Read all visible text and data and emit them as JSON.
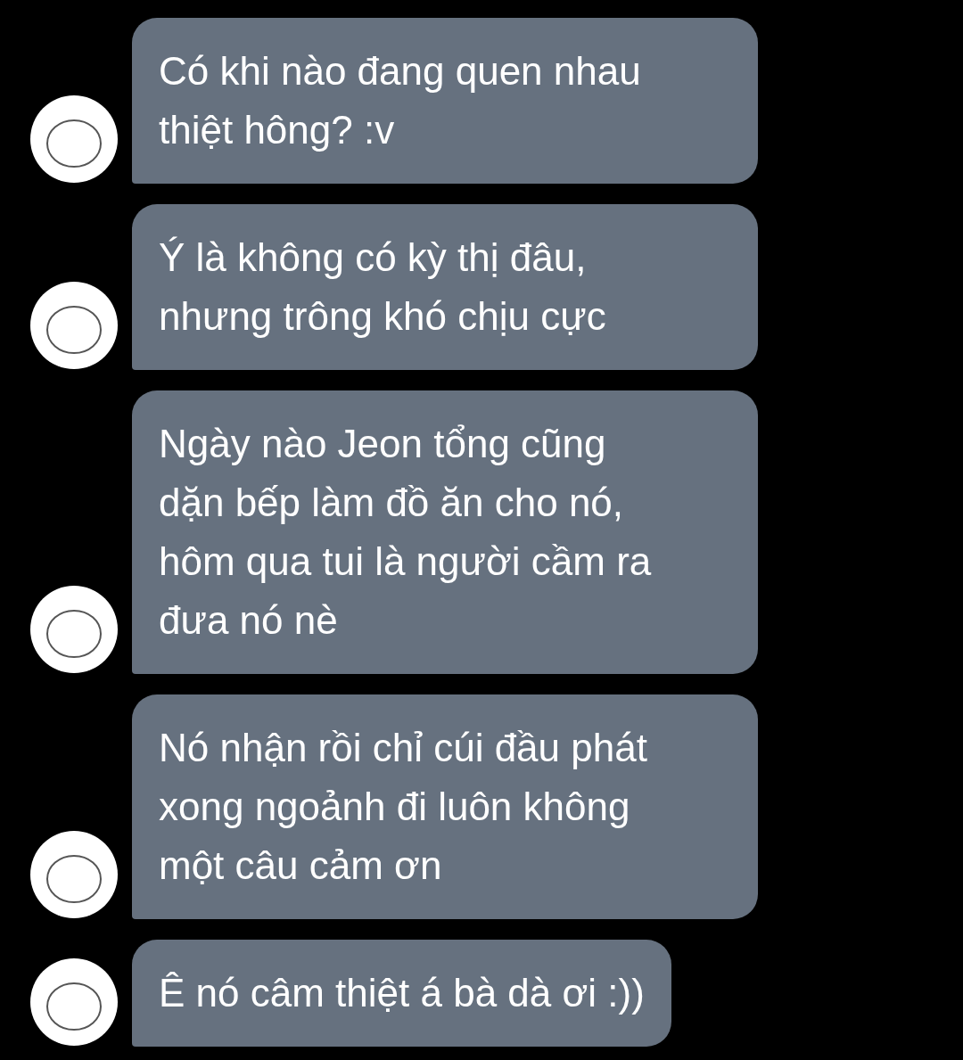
{
  "messages": [
    {
      "text": "Có khi nào đang quen nhau\nthiệt hông? :v"
    },
    {
      "text": "Ý là không có kỳ thị đâu,\nnhưng trông khó chịu cực"
    },
    {
      "text": "Ngày nào Jeon tổng cũng\ndặn bếp làm đồ ăn cho nó,\nhôm qua tui là người cầm ra\nđưa nó nè"
    },
    {
      "text": "Nó nhận rồi chỉ cúi đầu phát\nxong ngoảnh đi luôn không\nmột câu cảm ơn"
    },
    {
      "text": "Ê nó câm thiệt á bà dà ơi :))"
    }
  ]
}
